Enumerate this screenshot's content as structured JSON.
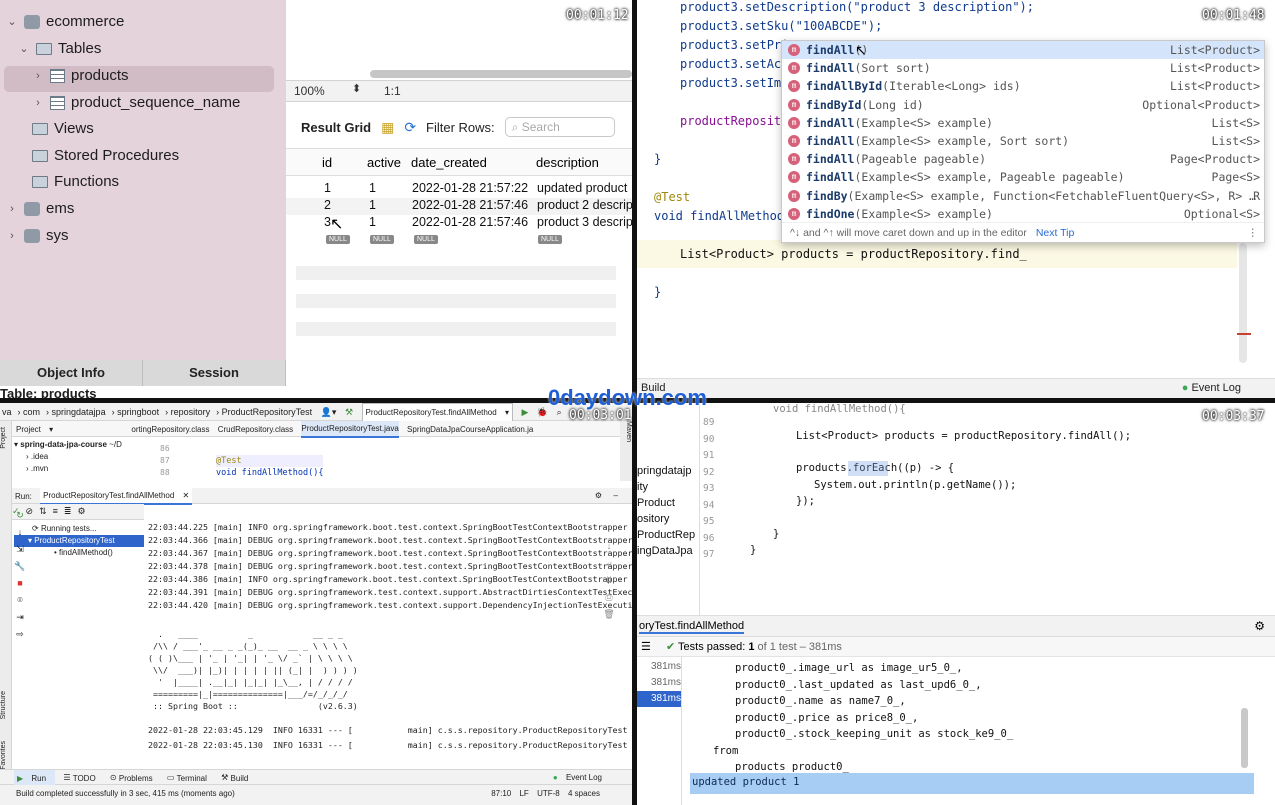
{
  "timestamps": [
    "00:01:12",
    "00:01:48",
    "00:03:01",
    "00:03:37"
  ],
  "watermark": "0daydown.com",
  "q1": {
    "tree": {
      "db": "ecommerce",
      "tables": "Tables",
      "t1": "products",
      "t2": "product_sequence_name",
      "views": "Views",
      "procs": "Stored Procedures",
      "funcs": "Functions",
      "db2": "ems",
      "db3": "sys"
    },
    "footer": {
      "obj": "Object Info",
      "sess": "Session",
      "table": "Table: products"
    },
    "zoom": "100%",
    "ratio": "1:1",
    "toolbar": {
      "result": "Result Grid",
      "filter": "Filter Rows:",
      "search": "Search"
    },
    "headers": [
      "id",
      "active",
      "date_created",
      "description"
    ],
    "rows": [
      [
        "1",
        "1",
        "2022-01-28 21:57:22",
        "updated product"
      ],
      [
        "2",
        "1",
        "2022-01-28 21:57:46",
        "product 2 descrip"
      ],
      [
        "3",
        "1",
        "2022-01-28 21:57:46",
        "product 3 descrip"
      ]
    ],
    "null": "NULL"
  },
  "q2": {
    "lines": [
      "product3.setDescription(\"product 3 description\");",
      "product3.setSku(\"100ABCDE\");",
      "product3.setPri",
      "product3.setActi",
      "product3.setImag",
      "productReposito",
      "}",
      "@Test",
      "void findAllMethod()",
      "List<Product> products = productRepository.find_",
      "}"
    ],
    "popup": [
      {
        "n": "findAll",
        "p": "()",
        "r": "List<Product>"
      },
      {
        "n": "findAll",
        "p": "(Sort sort)",
        "r": "List<Product>"
      },
      {
        "n": "findAllById",
        "p": "(Iterable<Long> ids)",
        "r": "List<Product>"
      },
      {
        "n": "findById",
        "p": "(Long id)",
        "r": "Optional<Product>"
      },
      {
        "n": "findAll",
        "p": "(Example<S> example)",
        "r": "List<S>"
      },
      {
        "n": "findAll",
        "p": "(Example<S> example, Sort sort)",
        "r": "List<S>"
      },
      {
        "n": "findAll",
        "p": "(Pageable pageable)",
        "r": "Page<Product>"
      },
      {
        "n": "findAll",
        "p": "(Example<S> example, Pageable pageable)",
        "r": "Page<S>"
      },
      {
        "n": "findBy",
        "p": "(Example<S> example, Function<FetchableFluentQuery<S>, R> …",
        "r": "R"
      },
      {
        "n": "findOne",
        "p": "(Example<S> example)",
        "r": "Optional<S>"
      }
    ],
    "tip": "^↓ and ^↑ will move caret down and up in the editor",
    "nexttip": "Next Tip",
    "build": "Build",
    "eventlog": "Event Log"
  },
  "q3": {
    "breadcrumb": [
      "va",
      "com",
      "springdatajpa",
      "springboot",
      "repository",
      "ProductRepositoryTest"
    ],
    "runconfig": "ProductRepositoryTest.findAllMethod",
    "tabs": [
      "ortingRepository.class",
      "CrudRepository.class",
      "ProductRepositoryTest.java",
      "SpringDataJpaCourseApplication.ja"
    ],
    "project": "Project",
    "projroot": "spring-data-jpa-course",
    "projsuffix": "~/D",
    "idea": ".idea",
    "mvn": ".mvn",
    "gutter": [
      "86",
      "87",
      "88"
    ],
    "ann": "@Test",
    "method": "void findAllMethod(){",
    "runlabel": "Run:",
    "runtab": "ProductRepositoryTest.findAllMethod",
    "running": "Running tests...",
    "testclass": "ProductRepositoryTest",
    "testmethod": "findAllMethod()",
    "log": [
      "22:03:44.225 [main] INFO org.springframework.boot.test.context.SpringBootTestContextBootstrapper -",
      "22:03:44.366 [main] DEBUG org.springframework.boot.test.context.SpringBootTestContextBootstrapper -",
      "22:03:44.367 [main] DEBUG org.springframework.boot.test.context.SpringBootTestContextBootstrapper -",
      "22:03:44.378 [main] DEBUG org.springframework.boot.test.context.SpringBootTestContextBootstrapper -",
      "22:03:44.386 [main] INFO org.springframework.boot.test.context.SpringBootTestContextBootstrapper -",
      "22:03:44.391 [main] DEBUG org.springframework.test.context.support.AbstractDirtiesContextTestExecut",
      "22:03:44.420 [main] DEBUG org.springframework.test.context.support.DependencyInjectionTestExecution"
    ],
    "banner": [
      "  .   ____          _            __ _ _",
      " /\\\\ / ___'_ __ _ _(_)_ __  __ _ \\ \\ \\ \\",
      "( ( )\\___ | '_ | '_| | '_ \\/ _` | \\ \\ \\ \\",
      " \\\\/  ___)| |_)| | | | | || (_| |  ) ) ) )",
      "  '  |____| .__|_| |_|_| |_\\__, | / / / /",
      " =========|_|==============|___/=/_/_/_/",
      " :: Spring Boot ::                (v2.6.3)"
    ],
    "log2": [
      "2022-01-28 22:03:45.129  INFO 16331 --- [           main] c.s.s.repository.ProductRepositoryTest",
      "2022-01-28 22:03:45.130  INFO 16331 --- [           main] c.s.s.repository.ProductRepositoryTest"
    ],
    "bottomtabs": [
      "Run",
      "TODO",
      "Problems",
      "Terminal",
      "Build"
    ],
    "eventlog": "Event Log",
    "status": "Build completed successfully in 3 sec, 415 ms (moments ago)",
    "statusright": [
      "87:10",
      "LF",
      "UTF-8",
      "4 spaces"
    ],
    "vtabs": [
      "Project",
      "Structure",
      "Favorites",
      "Maven"
    ]
  },
  "q4": {
    "gutter": [
      "89",
      "90",
      "91",
      "92",
      "93",
      "94",
      "95",
      "96",
      "97"
    ],
    "proj": [
      "pringdatajp",
      "ity",
      "Product",
      "ository",
      "ProductRep",
      "ingDataJpa"
    ],
    "code": [
      "List<Product> products = productRepository.findAll();",
      "products.forEach((p) -> {",
      "System.out.println(p.getName());",
      "});",
      "}",
      "}"
    ],
    "runtab": "oryTest.findAllMethod",
    "passed": "Tests passed:",
    "passcount": "1",
    "passof": "of 1 test – 381ms",
    "times": [
      "381ms",
      "381ms",
      "381ms"
    ],
    "sql": [
      "product0_.image_url as image_ur5_0_,",
      "product0_.last_updated as last_upd6_0_,",
      "product0_.name as name7_0_,",
      "product0_.price as price8_0_,",
      "product0_.stock_keeping_unit as stock_ke9_0_",
      "from",
      "products product0_"
    ],
    "output": "updated product 1",
    "prevline": "void findAllMethod(){"
  }
}
